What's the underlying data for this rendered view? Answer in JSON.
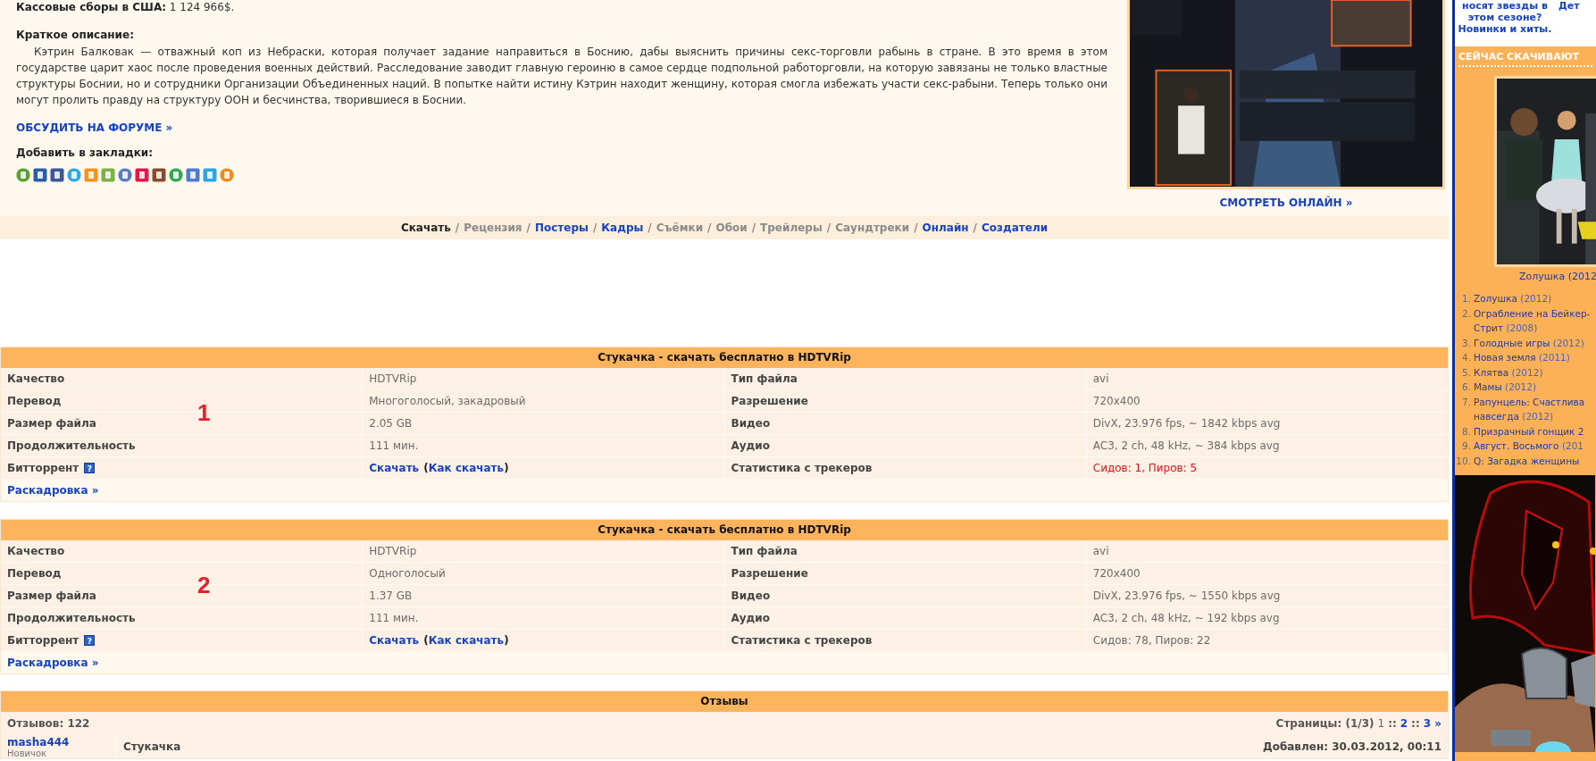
{
  "box_office": {
    "label": "Кассовые сборы в США:",
    "value": "1 124 966$."
  },
  "synopsis": {
    "label": "Краткое описание:",
    "text": "Кэтрин Балковак — отважный коп из Небраски, которая получает задание направиться в Боснию, дабы выяснить причины секс-торговли рабынь в стране. В это время в этом государстве царит хаос после проведения военных действий. Расследование заводит главную героиню в самое сердце подпольной работорговли, на которую завязаны не только властные структуры Боснии, но и сотрудники Организации Объединенных наций. В попытке найти истину Кэтрин находит женщину, которая смогла избежать участи секс-рабыни. Теперь только они могут пролить правду на структуру ООН и бесчинства, творившиеся в Боснии."
  },
  "forum_link": "ОБСУДИТЬ НА ФОРУМЕ »",
  "bookmarks_label": "Добавить в закладки:",
  "watch_online": "СМОТРЕТЬ ОНЛАЙН »",
  "nav_separator": "/",
  "nav": [
    {
      "label": "Скачать",
      "kind": "current"
    },
    {
      "label": "Рецензия",
      "kind": "inactive"
    },
    {
      "label": "Постеры",
      "kind": "link"
    },
    {
      "label": "Кадры",
      "kind": "link"
    },
    {
      "label": "Съёмки",
      "kind": "inactive"
    },
    {
      "label": "Обои",
      "kind": "inactive"
    },
    {
      "label": "Трейлеры",
      "kind": "inactive"
    },
    {
      "label": "Саундтреки",
      "kind": "inactive"
    },
    {
      "label": "Онлайн",
      "kind": "link"
    },
    {
      "label": "Создатели",
      "kind": "link"
    }
  ],
  "downloads": [
    {
      "title": "Стукачка - скачать бесплатно в HDTVRip",
      "annotation": "1",
      "rows": [
        {
          "label": "Качество",
          "value": "HDTVRip",
          "label_2": "Тип файла",
          "value_2": "avi"
        },
        {
          "label": "Перевод",
          "value": "Многоголосый, закадровый",
          "label_2": "Разрешение",
          "value_2": "720x400"
        },
        {
          "label": "Размер файла",
          "value": "2.05 GB",
          "label_2": "Видео",
          "value_2": "DivX, 23.976 fps, ~ 1842 kbps avg"
        },
        {
          "label": "Продолжительность",
          "value": "111 мин.",
          "label_2": "Аудио",
          "value_2": "AC3, 2 ch, 48 kHz, ~ 384 kbps avg"
        }
      ],
      "torrent": {
        "label": "Битторрент",
        "help": "?",
        "download": "Скачать",
        "how_to": [
          "(",
          "Как скачать",
          ")"
        ],
        "stats_label": "Статистика с трекеров",
        "stats": "Сидов: 1, Пиров: 5",
        "alert": true
      },
      "storyboard": "Раскадровка »"
    },
    {
      "title": "Стукачка - скачать бесплатно в HDTVRip",
      "annotation": "2",
      "rows": [
        {
          "label": "Качество",
          "value": "HDTVRip",
          "label_2": "Тип файла",
          "value_2": "avi"
        },
        {
          "label": "Перевод",
          "value": "Одноголосый",
          "label_2": "Разрешение",
          "value_2": "720x400"
        },
        {
          "label": "Размер файла",
          "value": "1.37 GB",
          "label_2": "Видео",
          "value_2": "DivX, 23.976 fps, ~ 1550 kbps avg"
        },
        {
          "label": "Продолжительность",
          "value": "111 мин.",
          "label_2": "Аудио",
          "value_2": "AC3, 2 ch, 48 kHz, ~ 192 kbps avg"
        }
      ],
      "torrent": {
        "label": "Битторрент",
        "help": "?",
        "download": "Скачать",
        "how_to": [
          "(",
          "Как скачать",
          ")"
        ],
        "stats_label": "Статистика с трекеров",
        "stats": "Сидов: 78, Пиров: 22",
        "alert": false
      },
      "storyboard": "Раскадровка »"
    }
  ],
  "reviews": {
    "title": "Отзывы",
    "count": "Отзывов: 122",
    "pages_label": "Страницы: (1/3)",
    "page_separator": "::",
    "pages": [
      {
        "label": "1",
        "selected": true
      },
      {
        "label": "2",
        "selected": false
      },
      {
        "label": "3 »",
        "selected": false
      }
    ],
    "first": {
      "user": "masha444",
      "rank": "Новичок",
      "subject": "Стукачка",
      "date": "Добавлен: 30.03.2012, 00:11"
    }
  },
  "sidebar": {
    "promo": [
      "носят звезды в этом сезоне? Новинки и хиты.",
      "Дет"
    ],
    "now_downloading": {
      "title": "СЕЙЧАС СКАЧИВАЮТ",
      "caption": "Zолушка (2012",
      "items": [
        {
          "number": "1.",
          "title": "Zолушка",
          "year": "(2012)"
        },
        {
          "number": "2.",
          "title": "Ограбление на Бейкер-Стрит",
          "year": "(2008)"
        },
        {
          "number": "3.",
          "title": "Голодные игры",
          "year": "(2012)"
        },
        {
          "number": "4.",
          "title": "Новая земля",
          "year": "(2011)"
        },
        {
          "number": "5.",
          "title": "Клятва",
          "year": "(2012)"
        },
        {
          "number": "6.",
          "title": "Мамы",
          "year": "(2012)"
        },
        {
          "number": "7.",
          "title": "Рапунцель: Счастлива навсегда",
          "year": "(2012)"
        },
        {
          "number": "8.",
          "title": "Призрачный гонщик 2"
        },
        {
          "number": "9.",
          "title": "Август. Восьмого",
          "year": "(201"
        },
        {
          "number": "10.",
          "title": "Q: Загадка женщины"
        }
      ]
    }
  }
}
